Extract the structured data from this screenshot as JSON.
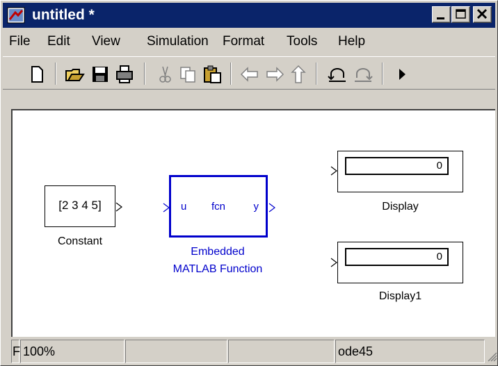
{
  "window": {
    "title": "untitled *"
  },
  "title_controls": [
    "minimize",
    "maximize",
    "close"
  ],
  "menu": [
    "File",
    "Edit",
    "View",
    "Simulation",
    "Format",
    "Tools",
    "Help"
  ],
  "toolbar_icons": [
    "new-icon",
    "open-icon",
    "save-icon",
    "print-icon",
    "cut-icon",
    "copy-icon",
    "paste-icon",
    "back-icon",
    "forward-icon",
    "up-icon",
    "undo-icon",
    "redo-icon",
    "run-icon"
  ],
  "blocks": {
    "constant": {
      "value": "[2 3 4 5]",
      "label": "Constant"
    },
    "emfunc": {
      "in_port": "u",
      "name": "fcn",
      "out_port": "y",
      "label_line1": "Embedded",
      "label_line2": "MATLAB Function",
      "color": "#0000cc"
    },
    "display": {
      "value": "0",
      "label": "Display"
    },
    "display1": {
      "value": "0",
      "label": "Display1"
    }
  },
  "status": {
    "cell0": "F",
    "zoom": "100%",
    "cell2": "",
    "cell3": "",
    "solver": "ode45"
  }
}
